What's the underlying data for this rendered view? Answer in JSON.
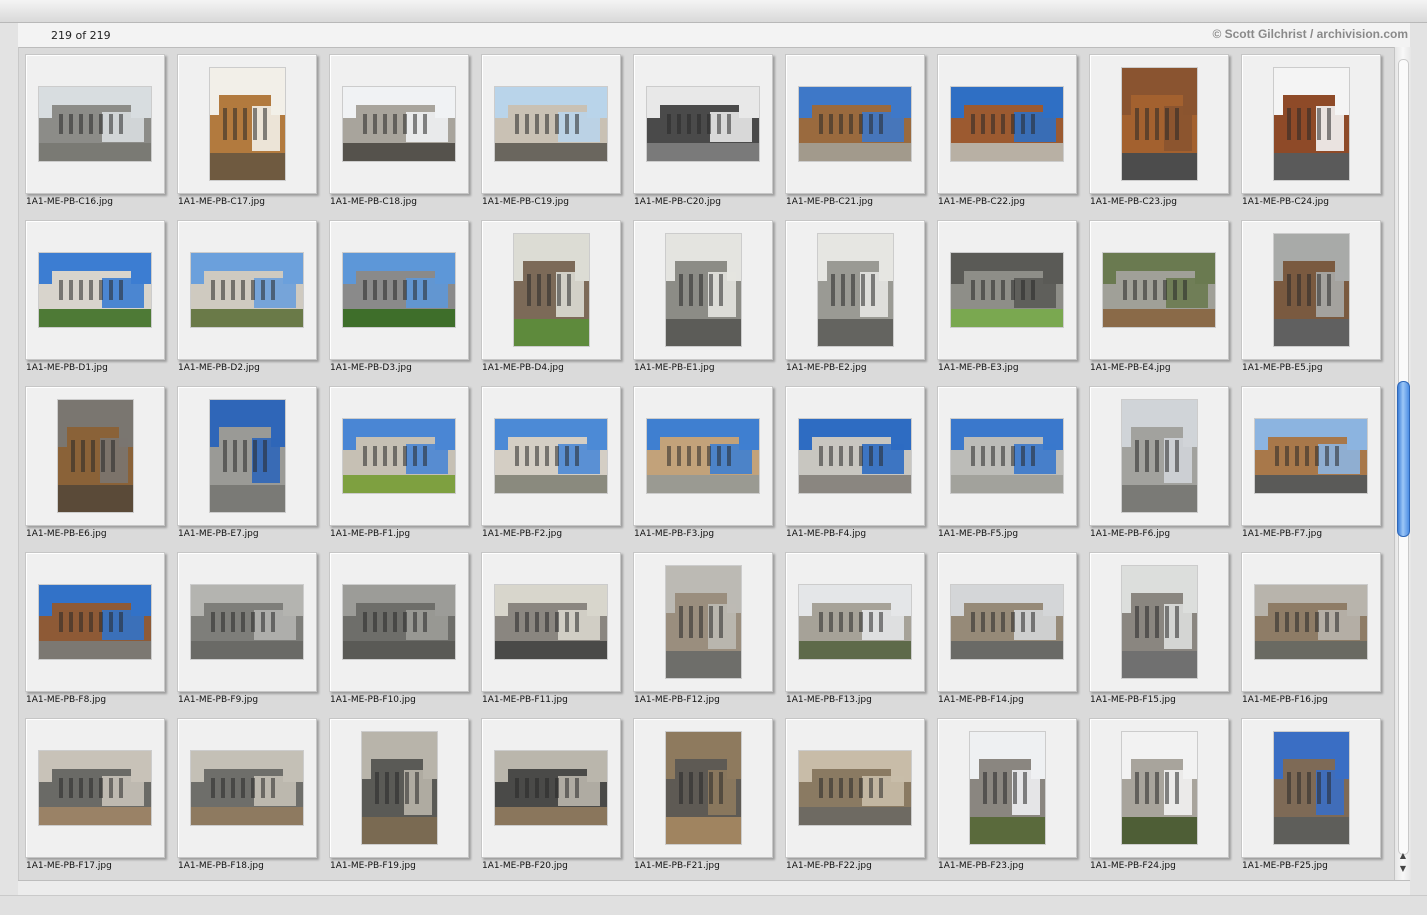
{
  "header": {
    "count_label": "219 of 219",
    "credit": "© Scott Gilchrist / archivision.com"
  },
  "thumbnails": [
    {
      "filename": "1A1-ME-PB-C16.jpg",
      "orientation": "landscape",
      "sky": "#d8dde0",
      "building": "#8c8c88",
      "ground": "#7a7a74"
    },
    {
      "filename": "1A1-ME-PB-C17.jpg",
      "orientation": "portrait",
      "sky": "#f2efe8",
      "building": "#b27a3e",
      "ground": "#6f5a40"
    },
    {
      "filename": "1A1-ME-PB-C18.jpg",
      "orientation": "landscape",
      "sky": "#f0f2f4",
      "building": "#a8a49c",
      "ground": "#55524c"
    },
    {
      "filename": "1A1-ME-PB-C19.jpg",
      "orientation": "landscape",
      "sky": "#b9d4ea",
      "building": "#c9c1b4",
      "ground": "#6a665e"
    },
    {
      "filename": "1A1-ME-PB-C20.jpg",
      "orientation": "landscape",
      "sky": "#e8e8e8",
      "building": "#4a4a4a",
      "ground": "#7a7a7a"
    },
    {
      "filename": "1A1-ME-PB-C21.jpg",
      "orientation": "landscape",
      "sky": "#3e78c8",
      "building": "#9a6a3e",
      "ground": "#a29a8c"
    },
    {
      "filename": "1A1-ME-PB-C22.jpg",
      "orientation": "landscape",
      "sky": "#2f6fc4",
      "building": "#9c5a30",
      "ground": "#b8b0a4"
    },
    {
      "filename": "1A1-ME-PB-C23.jpg",
      "orientation": "portrait",
      "sky": "#8a5430",
      "building": "#a3612f",
      "ground": "#4c4c4c"
    },
    {
      "filename": "1A1-ME-PB-C24.jpg",
      "orientation": "portrait",
      "sky": "#f4f4f4",
      "building": "#8e4a28",
      "ground": "#5a5a5a"
    },
    {
      "filename": "1A1-ME-PB-D1.jpg",
      "orientation": "landscape",
      "sky": "#3c7dd2",
      "building": "#d8d4cc",
      "ground": "#4e7a36"
    },
    {
      "filename": "1A1-ME-PB-D2.jpg",
      "orientation": "landscape",
      "sky": "#6ba0dc",
      "building": "#cfcac0",
      "ground": "#6a7a48"
    },
    {
      "filename": "1A1-ME-PB-D3.jpg",
      "orientation": "landscape",
      "sky": "#5d97d8",
      "building": "#8a8a8a",
      "ground": "#3e6e2a"
    },
    {
      "filename": "1A1-ME-PB-D4.jpg",
      "orientation": "portrait",
      "sky": "#dcdcd4",
      "building": "#7c6a58",
      "ground": "#5e8a3c"
    },
    {
      "filename": "1A1-ME-PB-E1.jpg",
      "orientation": "portrait",
      "sky": "#e4e4e0",
      "building": "#8c8c86",
      "ground": "#5c5c58"
    },
    {
      "filename": "1A1-ME-PB-E2.jpg",
      "orientation": "portrait",
      "sky": "#e6e6e2",
      "building": "#9a9a94",
      "ground": "#646460"
    },
    {
      "filename": "1A1-ME-PB-E3.jpg",
      "orientation": "landscape",
      "sky": "#5a5a56",
      "building": "#8e8e88",
      "ground": "#7aa850"
    },
    {
      "filename": "1A1-ME-PB-E4.jpg",
      "orientation": "landscape",
      "sky": "#6a7a50",
      "building": "#a0a098",
      "ground": "#8a6a48"
    },
    {
      "filename": "1A1-ME-PB-E5.jpg",
      "orientation": "portrait",
      "sky": "#a8aaa8",
      "building": "#7a5a40",
      "ground": "#606060"
    },
    {
      "filename": "1A1-ME-PB-E6.jpg",
      "orientation": "portrait",
      "sky": "#7a7670",
      "building": "#8a6238",
      "ground": "#5a4a38"
    },
    {
      "filename": "1A1-ME-PB-E7.jpg",
      "orientation": "portrait",
      "sky": "#2f66b8",
      "building": "#9a9a96",
      "ground": "#7a7a76"
    },
    {
      "filename": "1A1-ME-PB-F1.jpg",
      "orientation": "landscape",
      "sky": "#4a86d4",
      "building": "#c6c0b4",
      "ground": "#7ea040"
    },
    {
      "filename": "1A1-ME-PB-F2.jpg",
      "orientation": "landscape",
      "sky": "#4c8ad6",
      "building": "#d4cec4",
      "ground": "#8a8a7e"
    },
    {
      "filename": "1A1-ME-PB-F3.jpg",
      "orientation": "landscape",
      "sky": "#3f7fd0",
      "building": "#c2a27a",
      "ground": "#9a9a92"
    },
    {
      "filename": "1A1-ME-PB-F4.jpg",
      "orientation": "landscape",
      "sky": "#2e6cc2",
      "building": "#c8c6c0",
      "ground": "#8a8680"
    },
    {
      "filename": "1A1-ME-PB-F5.jpg",
      "orientation": "landscape",
      "sky": "#3a78cc",
      "building": "#bcbcb8",
      "ground": "#a2a29c"
    },
    {
      "filename": "1A1-ME-PB-F6.jpg",
      "orientation": "portrait",
      "sky": "#d0d4d8",
      "building": "#a2a29e",
      "ground": "#7a7a76"
    },
    {
      "filename": "1A1-ME-PB-F7.jpg",
      "orientation": "landscape",
      "sky": "#8cb4e0",
      "building": "#a8784a",
      "ground": "#5a5a58"
    },
    {
      "filename": "1A1-ME-PB-F8.jpg",
      "orientation": "landscape",
      "sky": "#3272c8",
      "building": "#8e5a36",
      "ground": "#7c7872"
    },
    {
      "filename": "1A1-ME-PB-F9.jpg",
      "orientation": "landscape",
      "sky": "#b4b4b0",
      "building": "#7e7e7a",
      "ground": "#6a6a66"
    },
    {
      "filename": "1A1-ME-PB-F10.jpg",
      "orientation": "landscape",
      "sky": "#9c9c98",
      "building": "#6e6e6a",
      "ground": "#5a5a56"
    },
    {
      "filename": "1A1-ME-PB-F11.jpg",
      "orientation": "landscape",
      "sky": "#d8d6cc",
      "building": "#8a8680",
      "ground": "#4a4a48"
    },
    {
      "filename": "1A1-ME-PB-F12.jpg",
      "orientation": "portrait",
      "sky": "#bcbab4",
      "building": "#9a8e7e",
      "ground": "#6e6e6a"
    },
    {
      "filename": "1A1-ME-PB-F13.jpg",
      "orientation": "landscape",
      "sky": "#e4e6e8",
      "building": "#a6a298",
      "ground": "#5e6a4a"
    },
    {
      "filename": "1A1-ME-PB-F14.jpg",
      "orientation": "landscape",
      "sky": "#d4d6d8",
      "building": "#968a78",
      "ground": "#6a6a66"
    },
    {
      "filename": "1A1-ME-PB-F15.jpg",
      "orientation": "portrait",
      "sky": "#dcdedc",
      "building": "#8a8680",
      "ground": "#707070"
    },
    {
      "filename": "1A1-ME-PB-F16.jpg",
      "orientation": "landscape",
      "sky": "#b8b4ac",
      "building": "#8e7c66",
      "ground": "#6a6a62"
    },
    {
      "filename": "1A1-ME-PB-F17.jpg",
      "orientation": "landscape",
      "sky": "#c8c2b8",
      "building": "#6a6a66",
      "ground": "#9a8266"
    },
    {
      "filename": "1A1-ME-PB-F18.jpg",
      "orientation": "landscape",
      "sky": "#c4c0b6",
      "building": "#6e6e6a",
      "ground": "#8e7a60"
    },
    {
      "filename": "1A1-ME-PB-F19.jpg",
      "orientation": "portrait",
      "sky": "#b8b4aa",
      "building": "#5a5a56",
      "ground": "#7a6a52"
    },
    {
      "filename": "1A1-ME-PB-F20.jpg",
      "orientation": "landscape",
      "sky": "#bab6ac",
      "building": "#4a4a48",
      "ground": "#8a765c"
    },
    {
      "filename": "1A1-ME-PB-F21.jpg",
      "orientation": "portrait",
      "sky": "#8e7a5e",
      "building": "#5e5a54",
      "ground": "#a08460"
    },
    {
      "filename": "1A1-ME-PB-F22.jpg",
      "orientation": "landscape",
      "sky": "#c8bca8",
      "building": "#8a7a62",
      "ground": "#6e6a62"
    },
    {
      "filename": "1A1-ME-PB-F23.jpg",
      "orientation": "portrait",
      "sky": "#eef0f2",
      "building": "#8a8680",
      "ground": "#5a6a3c"
    },
    {
      "filename": "1A1-ME-PB-F24.jpg",
      "orientation": "portrait",
      "sky": "#f2f2f2",
      "building": "#a8a49c",
      "ground": "#4e5e36"
    },
    {
      "filename": "1A1-ME-PB-F25.jpg",
      "orientation": "portrait",
      "sky": "#3a6ec4",
      "building": "#7e6a56",
      "ground": "#5e5e5a"
    }
  ]
}
